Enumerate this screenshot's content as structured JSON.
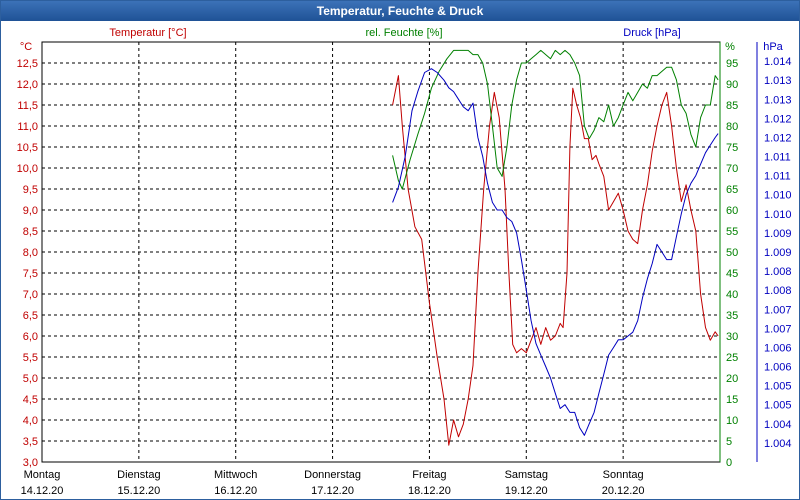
{
  "window": {
    "title": "Temperatur, Feuchte & Druck"
  },
  "legend": {
    "temperature": "Temperatur [°C]",
    "humidity": "rel. Feuchte [%]",
    "pressure": "Druck [hPa]"
  },
  "colors": {
    "temperature": "#c00000",
    "humidity": "#008000",
    "pressure": "#0000c0",
    "grid": "#000000",
    "title_bar": "#2a62a8"
  },
  "chart_data": {
    "type": "line",
    "title": "Temperatur, Feuchte & Druck",
    "grid": true,
    "x_unit_days": true,
    "xlim": [
      0,
      7
    ],
    "days": [
      {
        "weekday": "Montag",
        "date": "14.12.20"
      },
      {
        "weekday": "Dienstag",
        "date": "15.12.20"
      },
      {
        "weekday": "Mittwoch",
        "date": "16.12.20"
      },
      {
        "weekday": "Donnerstag",
        "date": "17.12.20"
      },
      {
        "weekday": "Freitag",
        "date": "18.12.20"
      },
      {
        "weekday": "Samstag",
        "date": "19.12.20"
      },
      {
        "weekday": "Sonntag",
        "date": "20.12.20"
      }
    ],
    "axes": {
      "temperature": {
        "unit": "°C",
        "min": 3.0,
        "max": 13.0,
        "step": 0.5,
        "tick_labels": [
          "3,0",
          "3,5",
          "4,0",
          "4,5",
          "5,0",
          "5,5",
          "6,0",
          "6,5",
          "7,0",
          "7,5",
          "8,0",
          "8,5",
          "9,0",
          "9,5",
          "10,0",
          "10,5",
          "11,0",
          "11,5",
          "12,0",
          "12,5"
        ]
      },
      "humidity": {
        "unit": "%",
        "min": 0,
        "max": 100,
        "step": 5,
        "tick_labels": [
          "0",
          "5",
          "10",
          "15",
          "20",
          "25",
          "30",
          "35",
          "40",
          "45",
          "50",
          "55",
          "60",
          "65",
          "70",
          "75",
          "80",
          "85",
          "90",
          "95"
        ]
      },
      "pressure": {
        "unit": "hPa",
        "min": 1.0035,
        "max": 1.0145,
        "step": 0.0005,
        "tick_labels": [
          "1.004",
          "1.004",
          "1.005",
          "1.005",
          "1.006",
          "1.006",
          "1.007",
          "1.007",
          "1.008",
          "1.008",
          "1.009",
          "1.009",
          "1.010",
          "1.010",
          "1.011",
          "1.011",
          "1.012",
          "1.012",
          "1.013",
          "1.013",
          "1.014"
        ]
      }
    },
    "series": [
      {
        "name": "Temperatur [°C]",
        "axis": "temperature",
        "x": [
          3.62,
          3.68,
          3.72,
          3.78,
          3.85,
          3.92,
          4.0,
          4.08,
          4.15,
          4.2,
          4.25,
          4.3,
          4.35,
          4.4,
          4.45,
          4.5,
          4.56,
          4.62,
          4.67,
          4.72,
          4.78,
          4.82,
          4.86,
          4.9,
          4.95,
          5.0,
          5.05,
          5.1,
          5.15,
          5.2,
          5.25,
          5.3,
          5.35,
          5.38,
          5.42,
          5.45,
          5.48,
          5.52,
          5.56,
          5.6,
          5.64,
          5.68,
          5.72,
          5.75,
          5.8,
          5.85,
          5.9,
          5.95,
          6.0,
          6.05,
          6.1,
          6.15,
          6.2,
          6.25,
          6.3,
          6.35,
          6.4,
          6.45,
          6.5,
          6.55,
          6.6,
          6.65,
          6.7,
          6.75,
          6.8,
          6.85,
          6.9,
          6.95,
          6.98
        ],
        "values": [
          11.5,
          12.2,
          11.0,
          9.5,
          8.6,
          8.3,
          6.8,
          5.5,
          4.5,
          3.4,
          4.0,
          3.6,
          3.9,
          4.5,
          5.3,
          7.5,
          9.5,
          11.0,
          11.8,
          11.2,
          9.5,
          7.5,
          5.8,
          5.6,
          5.7,
          5.6,
          5.9,
          6.2,
          5.8,
          6.2,
          5.9,
          6.0,
          6.3,
          6.2,
          7.5,
          10.5,
          11.9,
          11.5,
          11.2,
          10.7,
          10.7,
          10.2,
          10.3,
          10.1,
          9.8,
          9.0,
          9.2,
          9.4,
          9.0,
          8.5,
          8.3,
          8.2,
          9.0,
          9.6,
          10.4,
          11.0,
          11.5,
          11.8,
          11.0,
          10.0,
          9.2,
          9.6,
          9.0,
          8.5,
          7.0,
          6.2,
          5.9,
          6.1,
          6.0
        ]
      },
      {
        "name": "rel. Feuchte [%]",
        "axis": "humidity",
        "x": [
          3.62,
          3.68,
          3.72,
          3.8,
          3.88,
          3.95,
          4.02,
          4.1,
          4.18,
          4.25,
          4.32,
          4.4,
          4.45,
          4.5,
          4.55,
          4.6,
          4.65,
          4.7,
          4.75,
          4.8,
          4.85,
          4.9,
          4.95,
          5.0,
          5.05,
          5.1,
          5.15,
          5.2,
          5.25,
          5.3,
          5.35,
          5.4,
          5.45,
          5.5,
          5.55,
          5.6,
          5.65,
          5.7,
          5.75,
          5.8,
          5.85,
          5.9,
          5.95,
          6.0,
          6.05,
          6.1,
          6.15,
          6.2,
          6.25,
          6.3,
          6.35,
          6.4,
          6.45,
          6.5,
          6.55,
          6.6,
          6.65,
          6.7,
          6.75,
          6.8,
          6.85,
          6.9,
          6.95,
          6.98
        ],
        "values": [
          73,
          67,
          65,
          72,
          78,
          83,
          89,
          93,
          96,
          98,
          98,
          98,
          97,
          97,
          95,
          90,
          80,
          70,
          68,
          75,
          85,
          91,
          95,
          95,
          96,
          97,
          98,
          97,
          96,
          98,
          97,
          98,
          97,
          95,
          92,
          80,
          77,
          79,
          82,
          81,
          85,
          80,
          82,
          85,
          88,
          86,
          88,
          90,
          89,
          92,
          92,
          93,
          94,
          94,
          91,
          85,
          83,
          78,
          75,
          82,
          85,
          85,
          92,
          91
        ]
      },
      {
        "name": "Druck [hPa]",
        "axis": "pressure",
        "x": [
          3.62,
          3.68,
          3.75,
          3.82,
          3.88,
          3.95,
          4.02,
          4.08,
          4.15,
          4.2,
          4.25,
          4.3,
          4.35,
          4.4,
          4.45,
          4.5,
          4.55,
          4.6,
          4.65,
          4.7,
          4.75,
          4.8,
          4.85,
          4.9,
          4.95,
          5.0,
          5.05,
          5.1,
          5.15,
          5.2,
          5.25,
          5.3,
          5.35,
          5.4,
          5.45,
          5.5,
          5.55,
          5.6,
          5.65,
          5.7,
          5.75,
          5.8,
          5.85,
          5.9,
          5.95,
          6.0,
          6.05,
          6.1,
          6.15,
          6.2,
          6.25,
          6.3,
          6.35,
          6.4,
          6.45,
          6.5,
          6.55,
          6.6,
          6.65,
          6.7,
          6.75,
          6.8,
          6.85,
          6.9,
          6.95,
          6.98
        ],
        "values": [
          1.0103,
          1.0107,
          1.0115,
          1.0127,
          1.0132,
          1.0137,
          1.0138,
          1.0137,
          1.0135,
          1.0133,
          1.0132,
          1.013,
          1.0128,
          1.0127,
          1.0129,
          1.012,
          1.0115,
          1.0108,
          1.0103,
          1.0101,
          1.0101,
          1.0099,
          1.0098,
          1.0095,
          1.0088,
          1.008,
          1.0072,
          1.0066,
          1.0063,
          1.006,
          1.0057,
          1.0053,
          1.0049,
          1.005,
          1.0048,
          1.0048,
          1.0044,
          1.0042,
          1.0045,
          1.0048,
          1.0053,
          1.0058,
          1.0063,
          1.0065,
          1.0067,
          1.0067,
          1.0068,
          1.0069,
          1.0072,
          1.0078,
          1.0083,
          1.0087,
          1.0092,
          1.009,
          1.0088,
          1.0088,
          1.0094,
          1.01,
          1.0105,
          1.0108,
          1.011,
          1.0113,
          1.0116,
          1.0118,
          1.012,
          1.0121
        ]
      }
    ]
  }
}
